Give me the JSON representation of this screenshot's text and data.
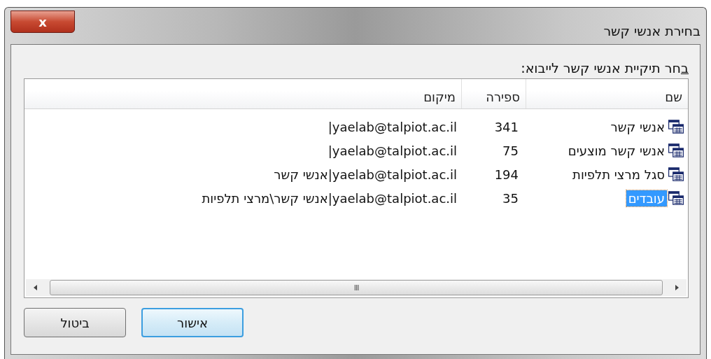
{
  "window": {
    "title": "בחירת אנשי קשר",
    "close_label": "x"
  },
  "prompt": "בחר תיקיית אנשי קשר לייבוא:",
  "table": {
    "columns": [
      "שם",
      "ספירה",
      "מיקום"
    ],
    "rows": [
      {
        "name": "אנשי קשר",
        "count": "341",
        "location": "yaelab@talpiot.ac.il|",
        "selected": false
      },
      {
        "name": "אנשי קשר מוצעים",
        "count": "75",
        "location": "yaelab@talpiot.ac.il|",
        "selected": false
      },
      {
        "name": "סגל מרצי תלפיות",
        "count": "194",
        "location": "yaelab@talpiot.ac.il|אנשי קשר",
        "selected": false
      },
      {
        "name": "עובדים",
        "count": "35",
        "location": "yaelab@talpiot.ac.il|אנשי קשר\\מרצי תלפיות",
        "selected": true
      }
    ],
    "scrollbar_grip": "III"
  },
  "buttons": [
    {
      "label": "אישור",
      "default": true
    },
    {
      "label": "ביטול",
      "default": false
    }
  ]
}
